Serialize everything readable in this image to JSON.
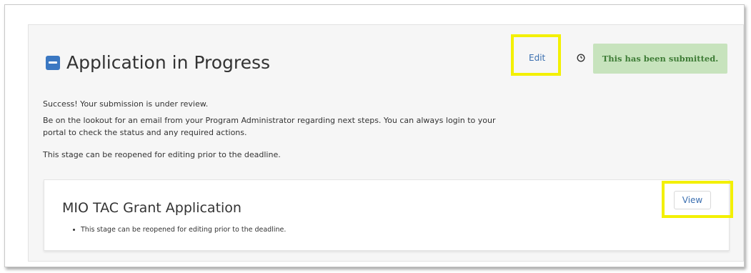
{
  "section": {
    "title": "Application in Progress",
    "edit_label": "Edit",
    "status_badge": "This has been submitted.",
    "messages": [
      "Success! Your submission is under review.",
      "Be on the lookout for an email from your Program Administrator regarding next steps. You can always login to your portal to check the status and any required actions.",
      "This stage can be reopened for editing prior to the deadline."
    ]
  },
  "card": {
    "title": "MIO TAC Grant Application",
    "bullets": [
      "This stage can be reopened for editing prior to the deadline."
    ],
    "view_label": "View"
  },
  "colors": {
    "accent": "#3b78c2",
    "link": "#3b6fb0",
    "badge_bg": "#c7e3bd",
    "badge_text": "#3e7c36",
    "highlight": "#f3f000"
  },
  "icons": {
    "collapse": "minus-square-icon",
    "clock": "clock-icon"
  }
}
